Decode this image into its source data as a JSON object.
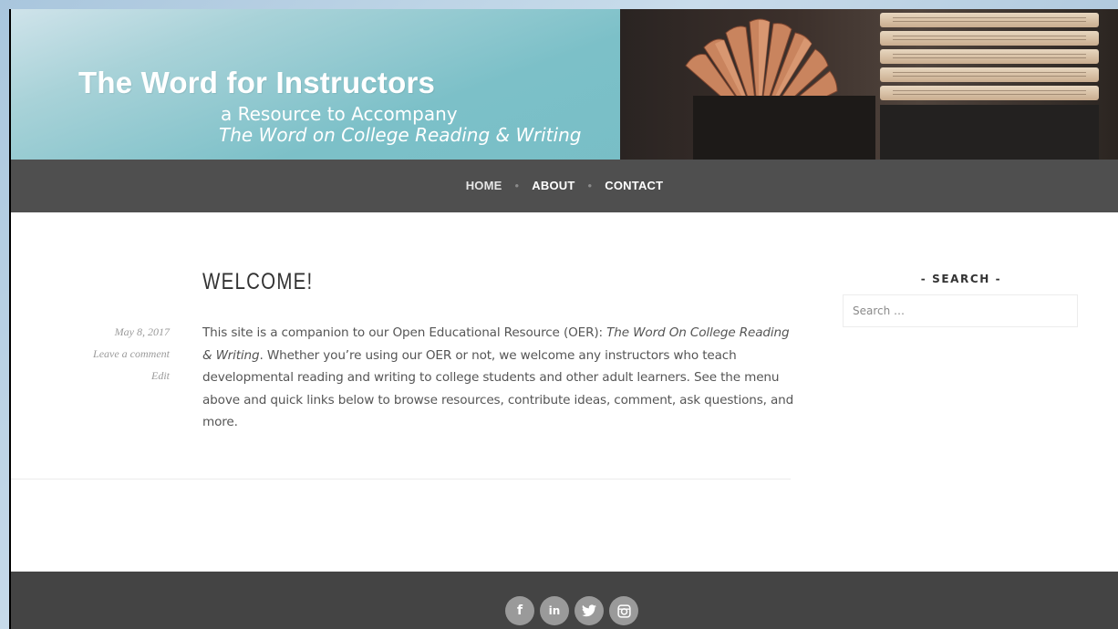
{
  "header": {
    "title": "The Word for Instructors",
    "tagline_line1": "a Resource to Accompany",
    "tagline_line2": "The Word on College Reading & Writing"
  },
  "nav": {
    "items": [
      {
        "label": "HOME"
      },
      {
        "label": "ABOUT"
      },
      {
        "label": "CONTACT"
      }
    ]
  },
  "post": {
    "title": "WELCOME!",
    "date": "May 8, 2017",
    "comment_link": "Leave a comment",
    "edit_link": "Edit",
    "body_intro": "This site is a companion to our Open Educational Resource (OER):  ",
    "body_title_italic": "The Word On College Reading & Writing",
    "body_rest": ". Whether you’re using our OER or not, we welcome any instructors who teach developmental reading and writing to college students and other adult learners.  See the menu above and quick links below to browse resources, contribute ideas, comment, ask questions, and more."
  },
  "sidebar": {
    "search_title": "- SEARCH -",
    "search_placeholder": "Search …"
  },
  "footer": {
    "social": [
      {
        "icon": "facebook-icon",
        "glyph": "f"
      },
      {
        "icon": "linkedin-icon",
        "glyph": "in"
      },
      {
        "icon": "twitter-icon",
        "glyph": "🐦"
      },
      {
        "icon": "instagram-icon",
        "glyph": "◎"
      }
    ]
  },
  "colors": {
    "header_teal": "#73bcc4",
    "nav_bg": "#4f4f4f",
    "footer_bg": "#444444",
    "social_icon_bg": "#9a9a9a"
  }
}
